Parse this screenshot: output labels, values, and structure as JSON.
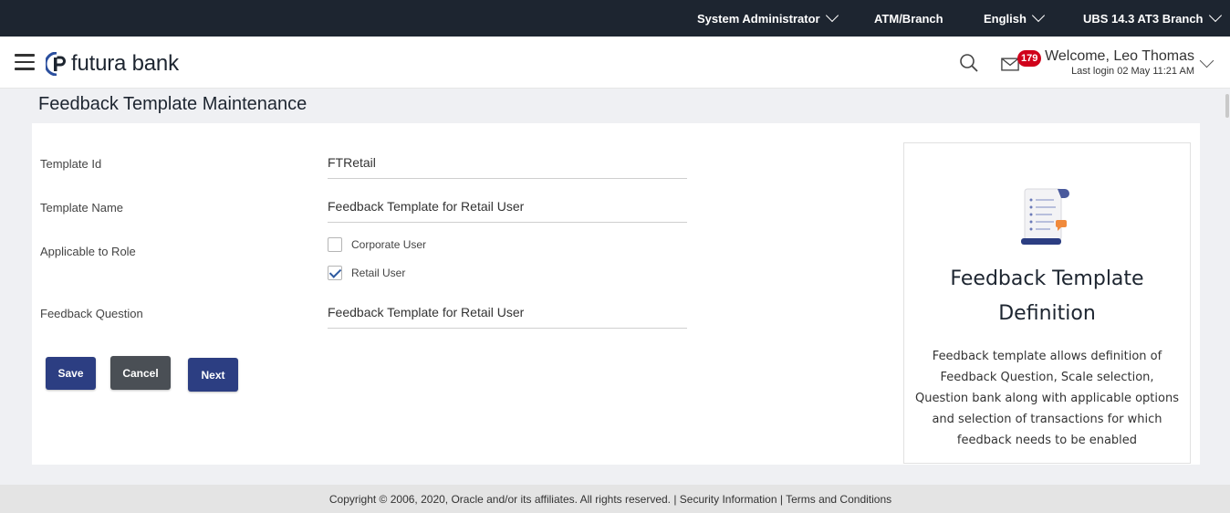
{
  "topbar": {
    "role": "System Administrator",
    "location": "ATM/Branch",
    "language": "English",
    "branch": "UBS 14.3 AT3 Branch"
  },
  "header": {
    "logo_text": "futura bank",
    "mail_count": "179",
    "welcome": "Welcome, Leo Thomas",
    "last_login": "Last login 02 May 11:21 AM"
  },
  "page": {
    "title": "Feedback Template Maintenance"
  },
  "form": {
    "template_id_label": "Template Id",
    "template_id_value": "FTRetail",
    "template_name_label": "Template Name",
    "template_name_value": "Feedback Template for Retail User",
    "role_label": "Applicable to Role",
    "roles": [
      {
        "label": "Corporate User",
        "checked": false
      },
      {
        "label": "Retail User",
        "checked": true
      }
    ],
    "question_label": "Feedback Question",
    "question_value": "Feedback Template for Retail User"
  },
  "buttons": {
    "save": "Save",
    "cancel": "Cancel",
    "next": "Next"
  },
  "side_panel": {
    "title": "Feedback Template Definition",
    "description": "Feedback template allows definition of Feedback Question, Scale selection, Question bank along with applicable options and selection of transactions for which feedback needs to be enabled"
  },
  "footer": {
    "text": "Copyright © 2006, 2020, Oracle and/or its affiliates. All rights reserved. | Security Information | Terms and Conditions"
  },
  "colors": {
    "topbar": "#1d2530",
    "primary_button": "#2c3e82",
    "secondary_button": "#4a4f55",
    "badge": "#d0021b"
  }
}
